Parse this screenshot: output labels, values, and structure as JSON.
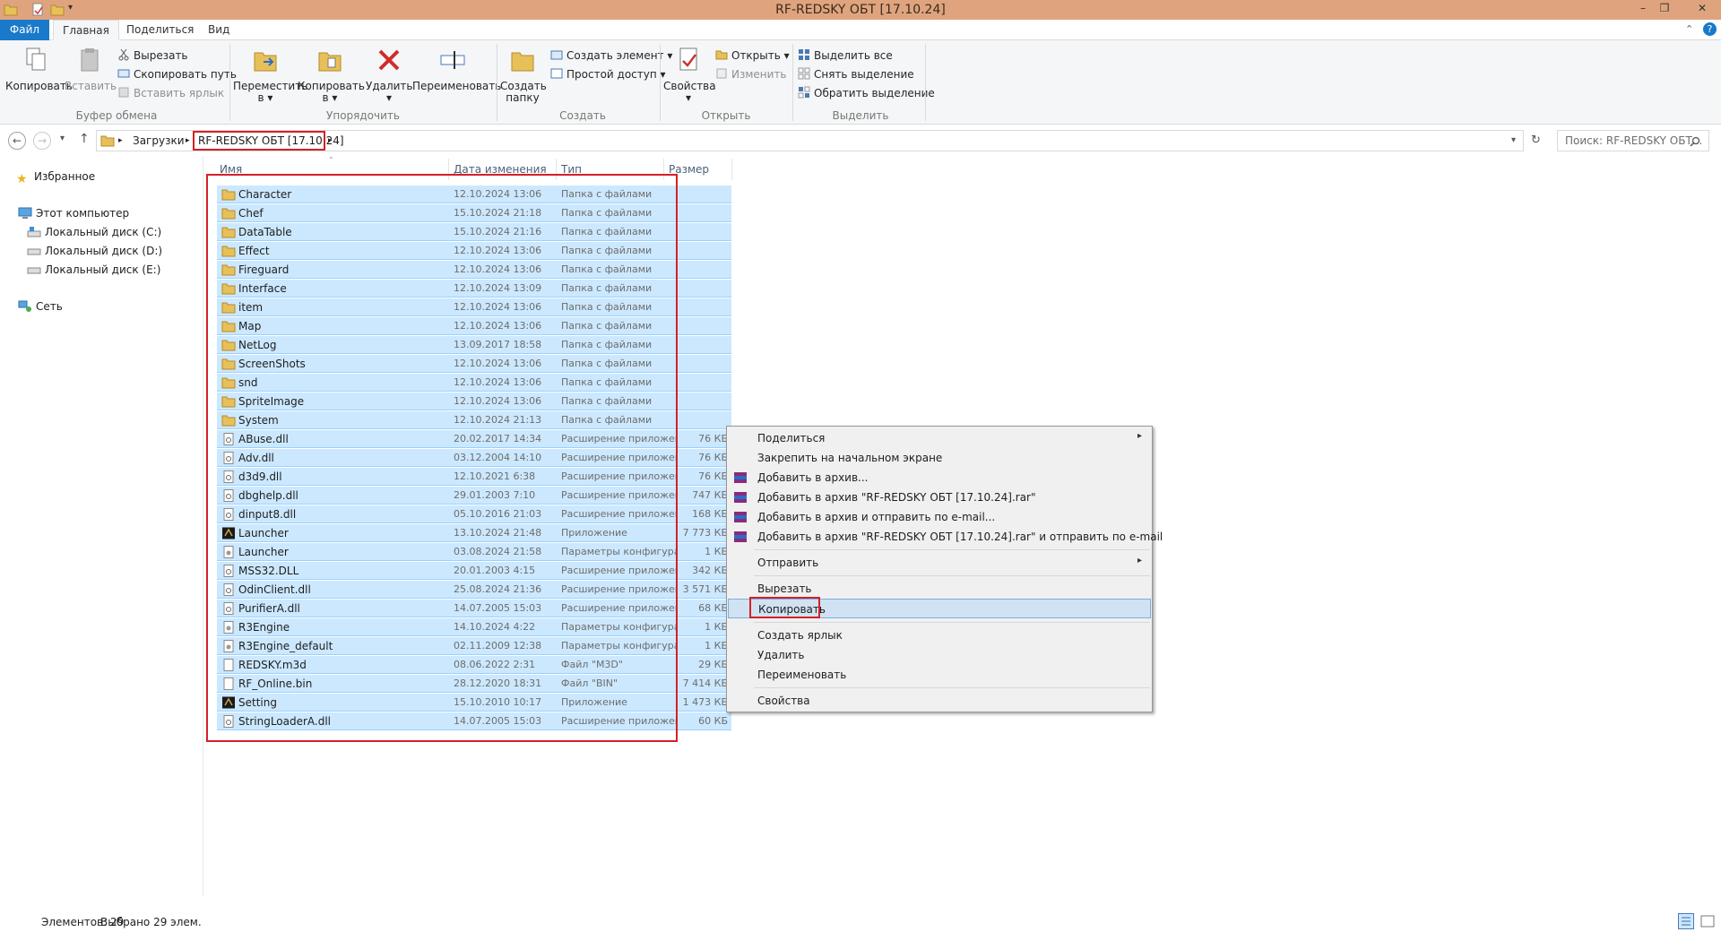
{
  "window": {
    "title": "RF-REDSKY ОБТ [17.10.24]",
    "minimize": "–",
    "maximize": "❐",
    "close": "✕"
  },
  "tabs": [
    "Файл",
    "Главная",
    "Поделиться",
    "Вид"
  ],
  "ribbon": {
    "clipboard": {
      "copy": "Копировать",
      "paste": "Вставить",
      "cut": "Вырезать",
      "copy_path": "Скопировать путь",
      "paste_shortcut": "Вставить ярлык",
      "label": "Буфер обмена"
    },
    "organize": {
      "move_to_1": "Переместить",
      "move_to_2": "в",
      "copy_to_1": "Копировать",
      "copy_to_2": "в",
      "delete": "Удалить",
      "rename": "Переименовать",
      "label": "Упорядочить"
    },
    "new": {
      "new_folder_1": "Создать",
      "new_folder_2": "папку",
      "new_item": "Создать элемент",
      "easy_access": "Простой доступ",
      "label": "Создать"
    },
    "open": {
      "properties": "Свойства",
      "open": "Открыть",
      "edit": "Изменить",
      "label": "Открыть"
    },
    "select": {
      "select_all": "Выделить все",
      "select_none": "Снять выделение",
      "invert": "Обратить выделение",
      "label": "Выделить"
    }
  },
  "address": {
    "crumbs": [
      "Загрузки",
      "RF-REDSKY ОБТ [17.10.24]"
    ],
    "search_placeholder": "Поиск: RF-REDSKY ОБТ..."
  },
  "nav": {
    "favorites": "Избранное",
    "this_pc": "Этот компьютер",
    "drives": [
      "Локальный диск (C:)",
      "Локальный диск (D:)",
      "Локальный диск (E:)"
    ],
    "network": "Сеть"
  },
  "columns": {
    "name": "Имя",
    "date": "Дата изменения",
    "type": "Тип",
    "size": "Размер"
  },
  "files": [
    {
      "name": "Character",
      "date": "12.10.2024 13:06",
      "type": "Папка с файлами",
      "size": "",
      "icon": "folder"
    },
    {
      "name": "Chef",
      "date": "15.10.2024 21:18",
      "type": "Папка с файлами",
      "size": "",
      "icon": "folder"
    },
    {
      "name": "DataTable",
      "date": "15.10.2024 21:16",
      "type": "Папка с файлами",
      "size": "",
      "icon": "folder"
    },
    {
      "name": "Effect",
      "date": "12.10.2024 13:06",
      "type": "Папка с файлами",
      "size": "",
      "icon": "folder"
    },
    {
      "name": "Fireguard",
      "date": "12.10.2024 13:06",
      "type": "Папка с файлами",
      "size": "",
      "icon": "folder"
    },
    {
      "name": "Interface",
      "date": "12.10.2024 13:09",
      "type": "Папка с файлами",
      "size": "",
      "icon": "folder"
    },
    {
      "name": "item",
      "date": "12.10.2024 13:06",
      "type": "Папка с файлами",
      "size": "",
      "icon": "folder"
    },
    {
      "name": "Map",
      "date": "12.10.2024 13:06",
      "type": "Папка с файлами",
      "size": "",
      "icon": "folder"
    },
    {
      "name": "NetLog",
      "date": "13.09.2017 18:58",
      "type": "Папка с файлами",
      "size": "",
      "icon": "folder"
    },
    {
      "name": "ScreenShots",
      "date": "12.10.2024 13:06",
      "type": "Папка с файлами",
      "size": "",
      "icon": "folder"
    },
    {
      "name": "snd",
      "date": "12.10.2024 13:06",
      "type": "Папка с файлами",
      "size": "",
      "icon": "folder"
    },
    {
      "name": "SpriteImage",
      "date": "12.10.2024 13:06",
      "type": "Папка с файлами",
      "size": "",
      "icon": "folder"
    },
    {
      "name": "System",
      "date": "12.10.2024 21:13",
      "type": "Папка с файлами",
      "size": "",
      "icon": "folder"
    },
    {
      "name": "ABuse.dll",
      "date": "20.02.2017 14:34",
      "type": "Расширение приложения",
      "size": "76 КБ",
      "icon": "dll"
    },
    {
      "name": "Adv.dll",
      "date": "03.12.2004 14:10",
      "type": "Расширение приложения",
      "size": "76 КБ",
      "icon": "dll"
    },
    {
      "name": "d3d9.dll",
      "date": "12.10.2021 6:38",
      "type": "Расширение приложения",
      "size": "76 КБ",
      "icon": "dll"
    },
    {
      "name": "dbghelp.dll",
      "date": "29.01.2003 7:10",
      "type": "Расширение приложения",
      "size": "747 КБ",
      "icon": "dll"
    },
    {
      "name": "dinput8.dll",
      "date": "05.10.2016 21:03",
      "type": "Расширение приложения",
      "size": "168 КБ",
      "icon": "dll"
    },
    {
      "name": "Launcher",
      "date": "13.10.2024 21:48",
      "type": "Приложение",
      "size": "7 773 КБ",
      "icon": "app"
    },
    {
      "name": "Launcher",
      "date": "03.08.2024 21:58",
      "type": "Параметры конфигурации",
      "size": "1 КБ",
      "icon": "ini"
    },
    {
      "name": "MSS32.DLL",
      "date": "20.01.2003 4:15",
      "type": "Расширение приложения",
      "size": "342 КБ",
      "icon": "dll"
    },
    {
      "name": "OdinClient.dll",
      "date": "25.08.2024 21:36",
      "type": "Расширение приложения",
      "size": "3 571 КБ",
      "icon": "dll"
    },
    {
      "name": "PurifierA.dll",
      "date": "14.07.2005 15:03",
      "type": "Расширение приложения",
      "size": "68 КБ",
      "icon": "dll"
    },
    {
      "name": "R3Engine",
      "date": "14.10.2024 4:22",
      "type": "Параметры конфигурации",
      "size": "1 КБ",
      "icon": "ini"
    },
    {
      "name": "R3Engine_default",
      "date": "02.11.2009 12:38",
      "type": "Параметры конфигурации",
      "size": "1 КБ",
      "icon": "ini"
    },
    {
      "name": "REDSKY.m3d",
      "date": "08.06.2022 2:31",
      "type": "Файл \"M3D\"",
      "size": "29 КБ",
      "icon": "file"
    },
    {
      "name": "RF_Online.bin",
      "date": "28.12.2020 18:31",
      "type": "Файл \"BIN\"",
      "size": "7 414 КБ",
      "icon": "file"
    },
    {
      "name": "Setting",
      "date": "15.10.2010 10:17",
      "type": "Приложение",
      "size": "1 473 КБ",
      "icon": "app"
    },
    {
      "name": "StringLoaderA.dll",
      "date": "14.07.2005 15:03",
      "type": "Расширение приложения",
      "size": "60 КБ",
      "icon": "dll"
    }
  ],
  "context_menu": {
    "share": "Поделиться",
    "pin_start": "Закрепить на начальном экране",
    "add_archive": "Добавить в архив...",
    "add_rar": "Добавить в архив \"RF-REDSKY ОБТ [17.10.24].rar\"",
    "add_email": "Добавить в архив и отправить по e-mail...",
    "add_rar_email": "Добавить в архив \"RF-REDSKY ОБТ [17.10.24].rar\" и отправить по e-mail",
    "send_to": "Отправить",
    "cut": "Вырезать",
    "copy": "Копировать",
    "create_shortcut": "Создать ярлык",
    "delete": "Удалить",
    "rename": "Переименовать",
    "properties": "Свойства"
  },
  "status": {
    "items": "Элементов: 29",
    "selected": "Выбрано 29 элем."
  },
  "colors": {
    "titlebar": "#dfa47e",
    "file_tab": "#1979ca",
    "selection": "#cce8ff",
    "highlight_red": "#d42027"
  }
}
